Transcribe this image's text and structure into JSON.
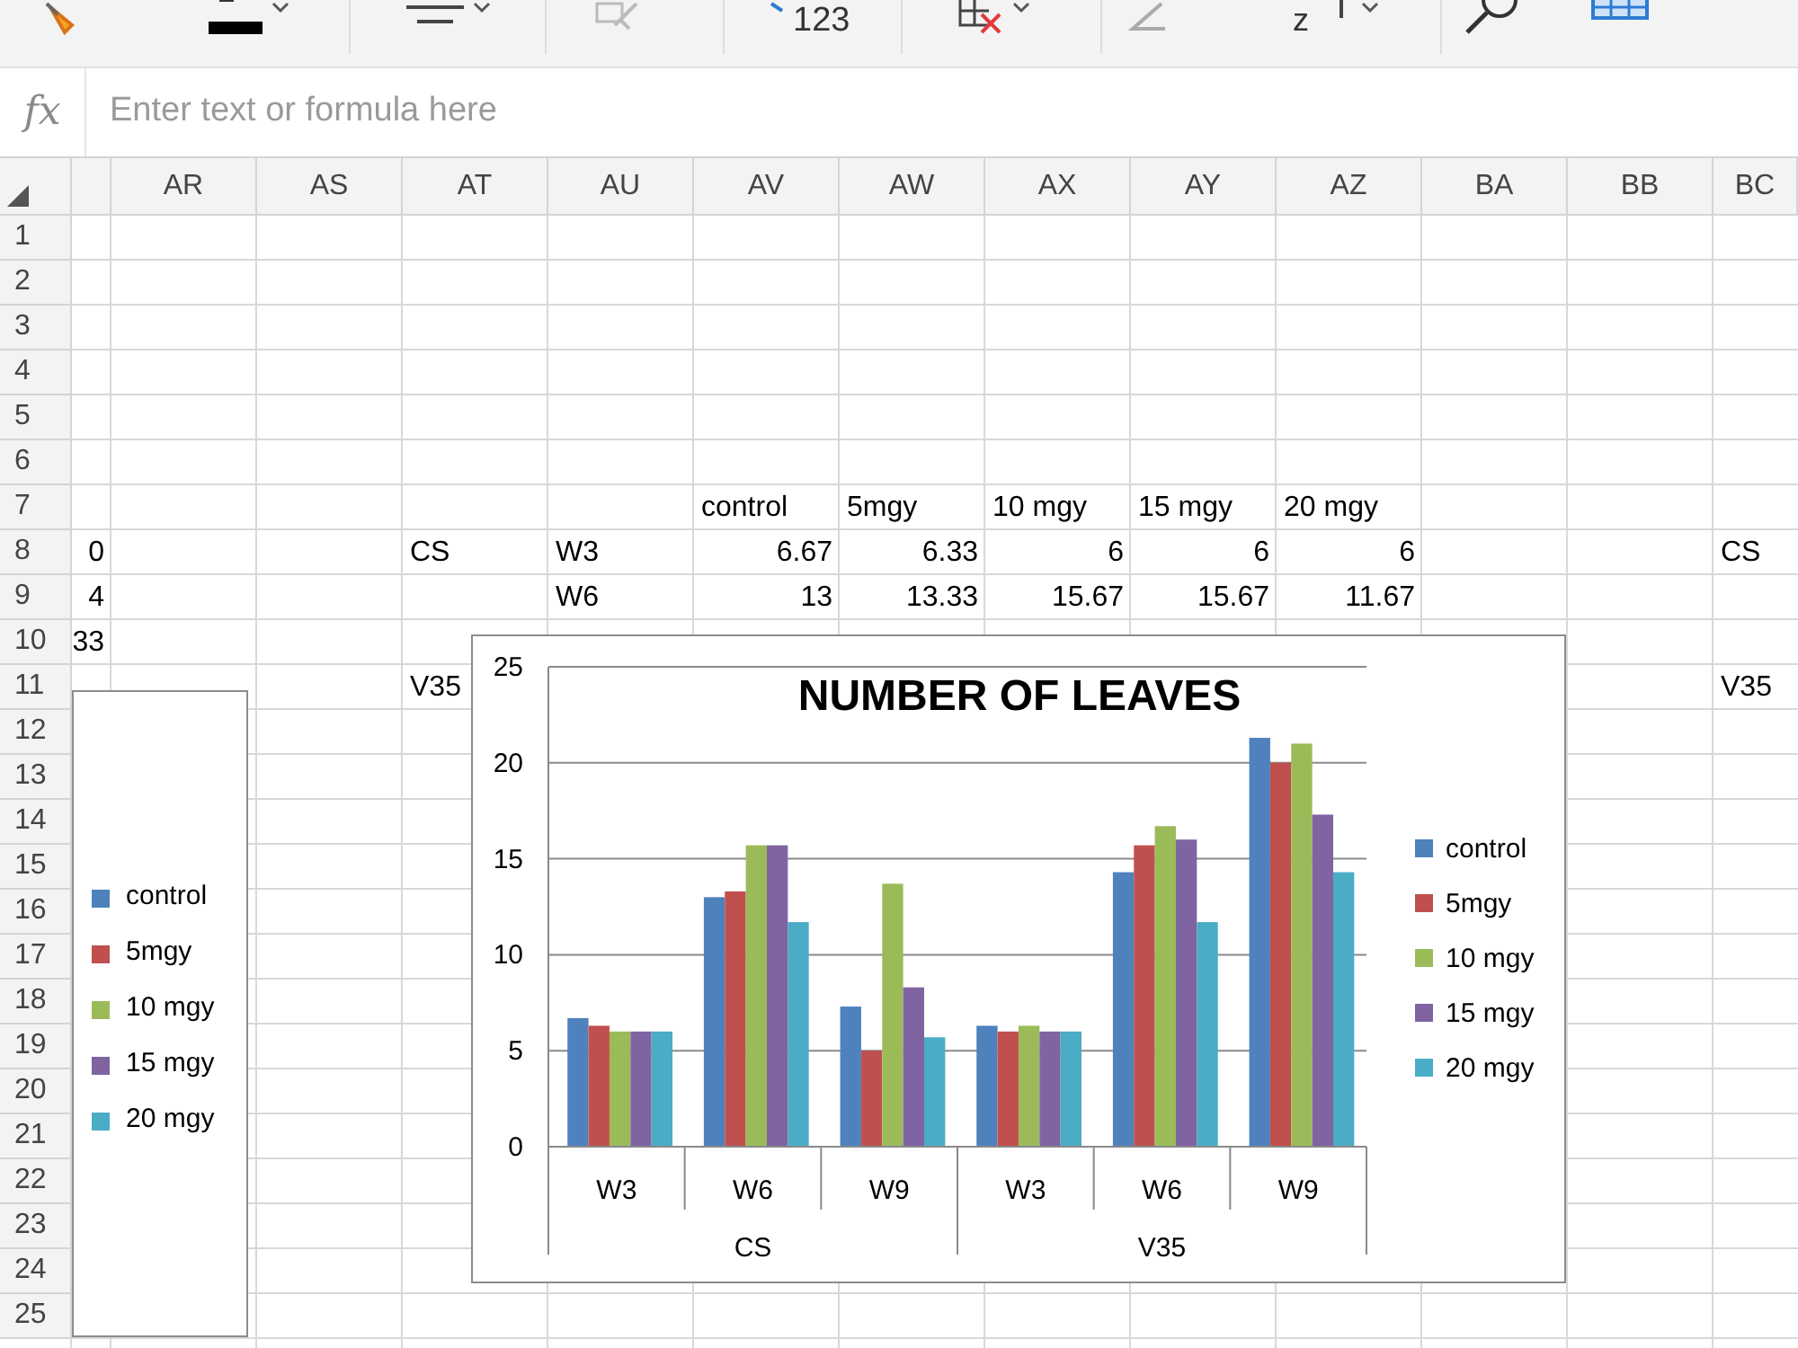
{
  "toolbar": [
    {
      "kind": "brush"
    },
    {
      "kind": "font-color"
    },
    {
      "kind": "align"
    },
    {
      "kind": "format-painter"
    },
    {
      "kind": "number-format",
      "text": "123"
    },
    {
      "kind": "clear"
    },
    {
      "kind": "sum"
    },
    {
      "kind": "sort",
      "text": "z"
    },
    {
      "kind": "find"
    },
    {
      "kind": "table"
    }
  ],
  "formula_bar": {
    "icon_text": "fx",
    "placeholder": "Enter text or formula here"
  },
  "columns": [
    "",
    "AR",
    "AS",
    "AT",
    "AU",
    "AV",
    "AW",
    "AX",
    "AY",
    "AZ",
    "BA",
    "BB",
    "BC"
  ],
  "rows": [
    {
      "header": "1",
      "cells": []
    },
    {
      "header": "2",
      "cells": []
    },
    {
      "header": "3",
      "cells": []
    },
    {
      "header": "4",
      "cells": []
    },
    {
      "header": "5",
      "cells": []
    },
    {
      "header": "6",
      "cells": []
    },
    {
      "header": "7",
      "cells": [
        null,
        null,
        null,
        null,
        null,
        "control",
        "5mgy",
        "10 mgy",
        "15 mgy",
        "20 mgy"
      ]
    },
    {
      "header": "8",
      "cells": [
        "0",
        null,
        null,
        "CS",
        "W3",
        "6.67",
        "6.33",
        "6",
        "6",
        "6",
        null,
        null,
        "CS"
      ]
    },
    {
      "header": "9",
      "cells": [
        "4",
        null,
        null,
        null,
        "W6",
        "13",
        "13.33",
        "15.67",
        "15.67",
        "11.67"
      ]
    },
    {
      "header": "10",
      "cells": [
        "33"
      ]
    },
    {
      "header": "11",
      "cells": [
        null,
        null,
        null,
        "V35",
        null,
        null,
        null,
        null,
        null,
        null,
        null,
        null,
        "V35"
      ]
    },
    {
      "header": "12",
      "cells": []
    },
    {
      "header": "13",
      "cells": []
    },
    {
      "header": "14",
      "cells": []
    },
    {
      "header": "15",
      "cells": []
    },
    {
      "header": "16",
      "cells": []
    },
    {
      "header": "17",
      "cells": []
    },
    {
      "header": "18",
      "cells": []
    },
    {
      "header": "19",
      "cells": []
    },
    {
      "header": "20",
      "cells": []
    },
    {
      "header": "21",
      "cells": []
    },
    {
      "header": "22",
      "cells": []
    },
    {
      "header": "23",
      "cells": []
    },
    {
      "header": "24",
      "cells": []
    },
    {
      "header": "25",
      "cells": []
    }
  ],
  "legend_box": {
    "items": [
      {
        "label": "control",
        "color": "#4f81bd"
      },
      {
        "label": "5mgy",
        "color": "#c0504d"
      },
      {
        "label": "10 mgy",
        "color": "#9bbb59"
      },
      {
        "label": "15 mgy",
        "color": "#8064a2"
      },
      {
        "label": "20 mgy",
        "color": "#4bacc6"
      }
    ]
  },
  "chart": {
    "category_groups": [
      {
        "label": "CS"
      },
      {
        "label": "V35"
      }
    ],
    "chart_data": {
      "type": "bar",
      "title": "NUMBER OF LEAVES",
      "categories": [
        "W3",
        "W6",
        "W9",
        "W3",
        "W6",
        "W9"
      ],
      "series": [
        {
          "name": "control",
          "color": "#4f81bd",
          "values": [
            6.7,
            13,
            7.3,
            6.3,
            14.3,
            21.3
          ]
        },
        {
          "name": "5mgy",
          "color": "#c0504d",
          "values": [
            6.3,
            13.3,
            5,
            6,
            15.7,
            20
          ]
        },
        {
          "name": "10 mgy",
          "color": "#9bbb59",
          "values": [
            6,
            15.7,
            13.7,
            6.3,
            16.7,
            21
          ]
        },
        {
          "name": "15 mgy",
          "color": "#8064a2",
          "values": [
            6,
            15.7,
            8.3,
            6,
            16,
            17.3
          ]
        },
        {
          "name": "20 mgy",
          "color": "#4bacc6",
          "values": [
            6,
            11.7,
            5.7,
            6,
            11.7,
            14.3
          ]
        }
      ],
      "ylim": [
        0,
        25
      ],
      "yticks": [
        {
          "value": 0,
          "label": "0"
        },
        {
          "value": 5,
          "label": "5"
        },
        {
          "value": 10,
          "label": "10"
        },
        {
          "value": 15,
          "label": "15"
        },
        {
          "value": 20,
          "label": "20"
        },
        {
          "value": 25,
          "label": "25"
        }
      ],
      "grid": true,
      "legend": true
    }
  }
}
